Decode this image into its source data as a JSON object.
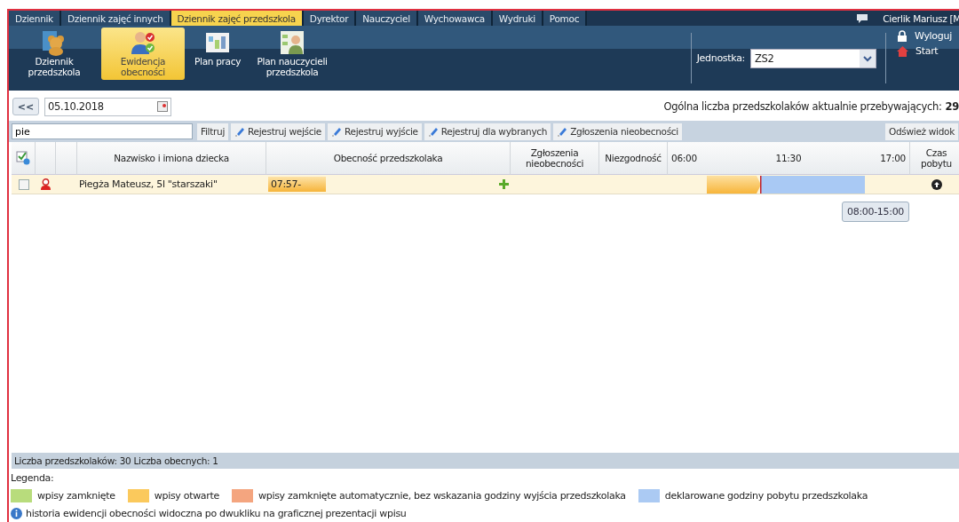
{
  "nav_tabs": [
    {
      "label": "Dziennik",
      "selected": false
    },
    {
      "label": "Dziennik zajęć innych",
      "selected": false
    },
    {
      "label": "Dziennik zajęć przedszkola",
      "selected": true
    },
    {
      "label": "Dyrektor",
      "selected": false
    },
    {
      "label": "Nauczyciel",
      "selected": false
    },
    {
      "label": "Wychowawca",
      "selected": false
    },
    {
      "label": "Wydruki",
      "selected": false
    },
    {
      "label": "Pomoc",
      "selected": false
    }
  ],
  "user": {
    "name": "Cierlik Mariusz [M"
  },
  "toolbar": [
    {
      "label": "Dziennik przedszkola",
      "kind": "bear",
      "selected": false
    },
    {
      "label": "Ewidencja obecności",
      "kind": "attendance",
      "selected": true
    },
    {
      "label": "Plan pracy",
      "kind": "plan",
      "selected": false
    },
    {
      "label": "Plan nauczycieli przedszkola",
      "kind": "teacher",
      "selected": false
    }
  ],
  "unit": {
    "label": "Jednostka:",
    "value": "ZS2"
  },
  "links": [
    {
      "label": "Wyloguj",
      "kind": "lock"
    },
    {
      "label": "Start",
      "kind": "home"
    }
  ],
  "date": {
    "back": "<<",
    "value": "05.10.2018"
  },
  "summary": {
    "label": "Ogólna liczba przedszkolaków aktualnie przebywających:",
    "value": "29"
  },
  "filter": {
    "value": "pie",
    "buttons": [
      {
        "label": "Filtruj",
        "kind": "plain"
      },
      {
        "label": "Rejestruj wejście",
        "kind": "pencil"
      },
      {
        "label": "Rejestruj wyjście",
        "kind": "pencil"
      },
      {
        "label": "Rejestruj dla wybranych",
        "kind": "pencil"
      },
      {
        "label": "Zgłoszenia nieobecności",
        "kind": "pencil"
      }
    ],
    "refresh": "Odśwież widok"
  },
  "table": {
    "columns": [
      "Nazwisko i imiona dziecka",
      "Obecność przedszkolaka",
      "Zgłoszenia nieobecności",
      "Niezgodność"
    ],
    "timeline_ticks": [
      "06:00",
      "11:30",
      "17:00"
    ],
    "last_column": "Czas pobytu",
    "rows": [
      {
        "checked": false,
        "selected": true,
        "name": "Piegża Mateusz, 5l \"starszaki\"",
        "entry": "07:57-"
      }
    ]
  },
  "tooltip": "08:00-15:00",
  "status_bar": "Liczba przedszkolaków: 30 Liczba obecnych: 1",
  "legend": {
    "title": "Legenda:",
    "items": [
      {
        "label": "wpisy zamknięte",
        "color": "#b8dc7c"
      },
      {
        "label": "wpisy otwarte",
        "color": "#fbc95c"
      },
      {
        "label": "wpisy zamknięte automatycznie, bez wskazania godziny wyjścia przedszkolaka",
        "color": "#f4a57f"
      },
      {
        "label": "deklarowane godziny pobytu przedszkolaka",
        "color": "#abcaf3"
      }
    ],
    "note": "historia ewidencji obecności widoczna po dwukliku na graficznej prezentacji wpisu"
  }
}
